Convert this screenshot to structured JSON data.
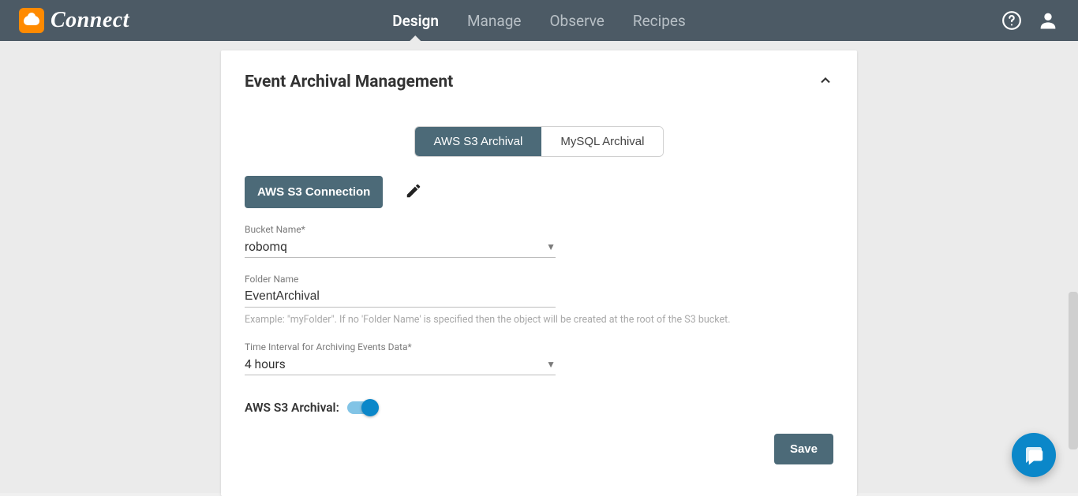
{
  "brand": {
    "name": "Connect"
  },
  "nav": {
    "items": [
      {
        "label": "Design",
        "active": true
      },
      {
        "label": "Manage",
        "active": false
      },
      {
        "label": "Observe",
        "active": false
      },
      {
        "label": "Recipes",
        "active": false
      }
    ]
  },
  "card": {
    "title": "Event Archival Management",
    "tabs": {
      "aws": "AWS S3 Archival",
      "mysql": "MySQL Archival"
    },
    "connection_button": "AWS S3 Connection",
    "fields": {
      "bucket": {
        "label": "Bucket Name*",
        "value": "robomq"
      },
      "folder": {
        "label": "Folder Name",
        "value": "EventArchival",
        "helper": "Example: \"myFolder\". If no 'Folder Name' is specified then the object will be created at the root of the S3 bucket."
      },
      "interval": {
        "label": "Time Interval for Archiving Events Data*",
        "value": "4 hours"
      }
    },
    "toggle": {
      "label": "AWS S3 Archival:",
      "on": true
    },
    "save_label": "Save"
  }
}
